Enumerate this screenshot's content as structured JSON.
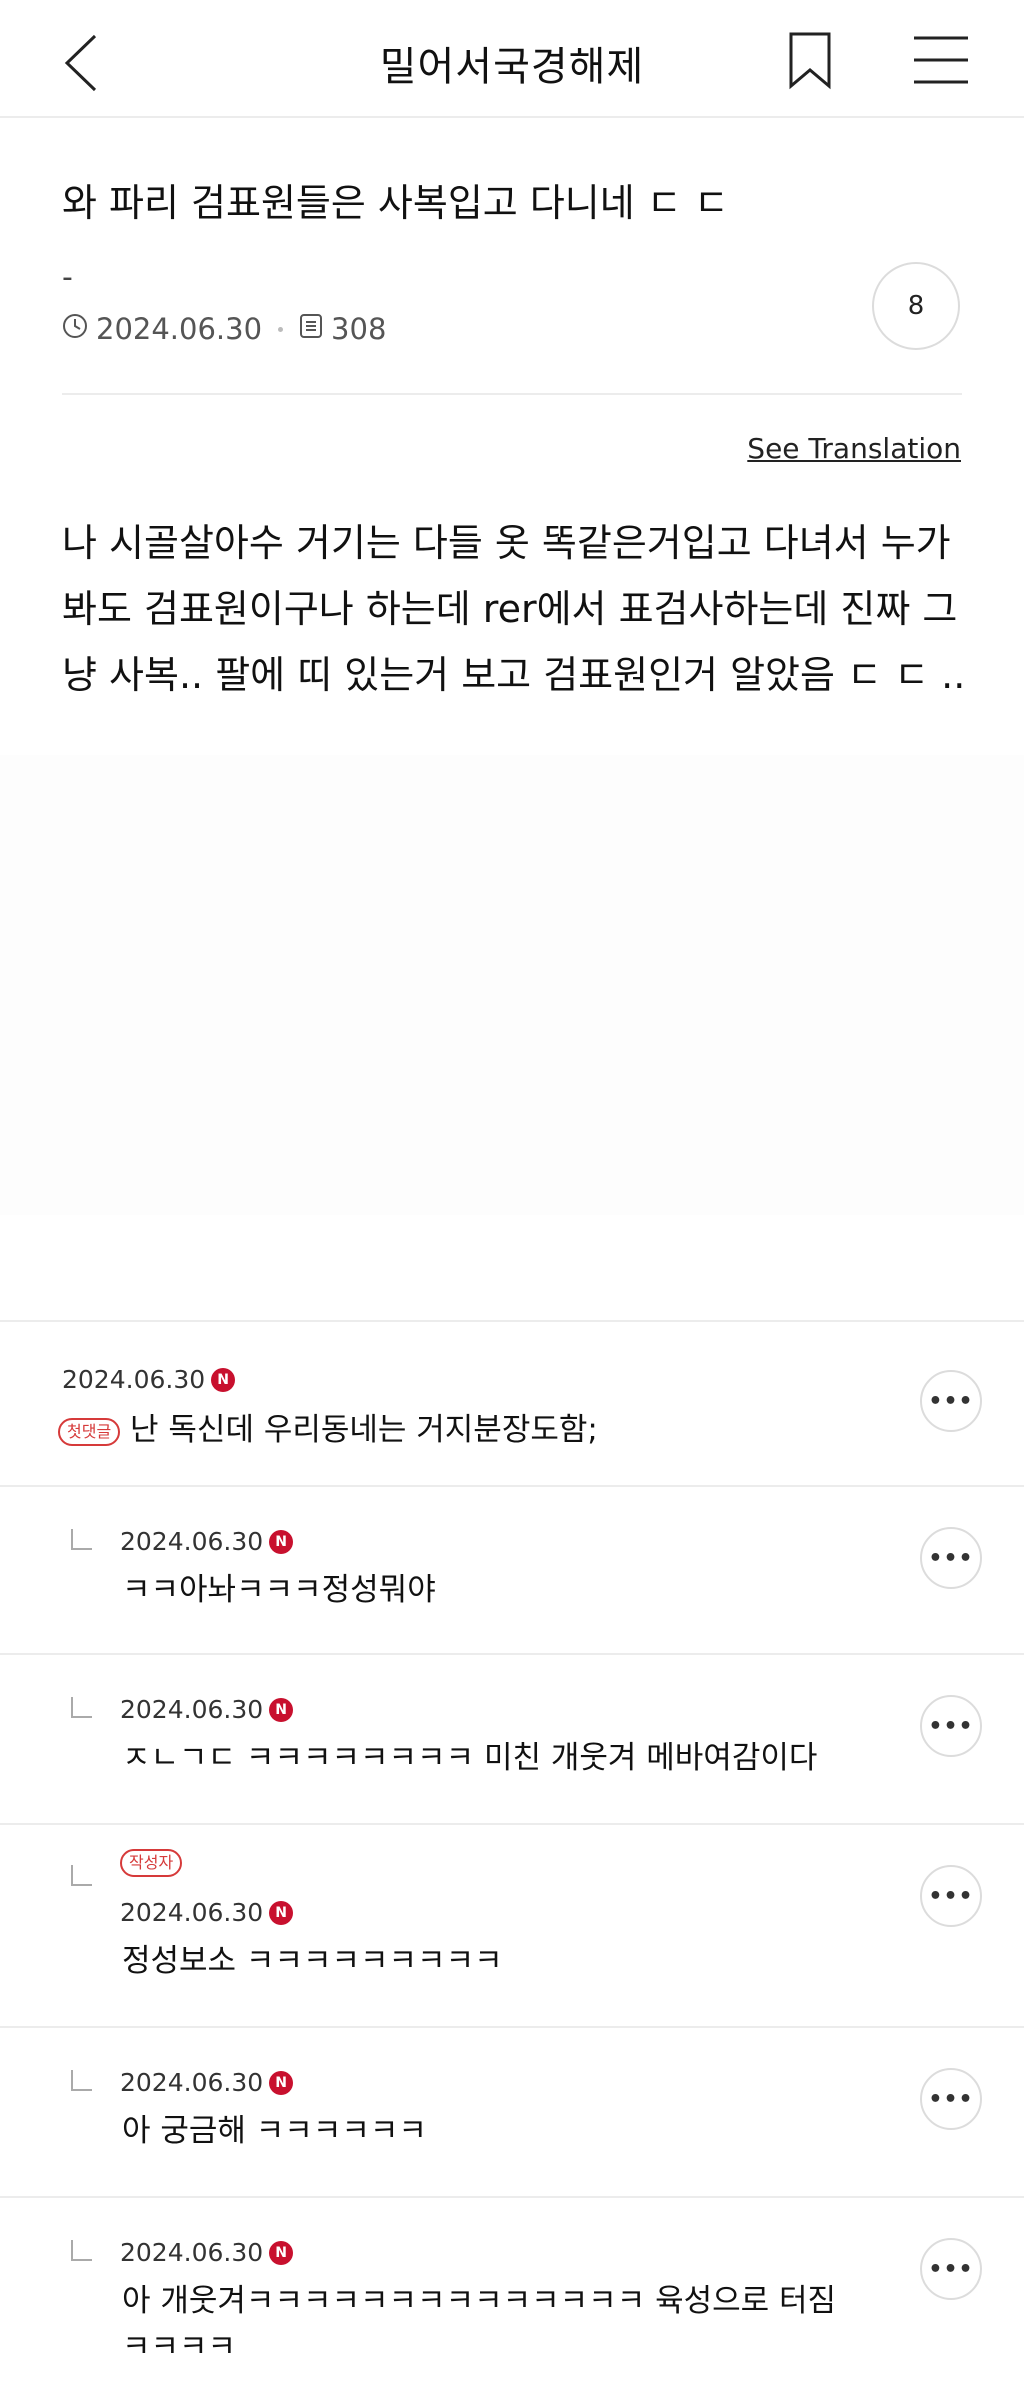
{
  "header": {
    "title": "밀어서국경해제",
    "back_icon": "chevron-left-icon",
    "bookmark_icon": "bookmark-icon",
    "menu_icon": "hamburger-menu-icon"
  },
  "post": {
    "title": "와 파리 검표원들은 사복입고 다니네 ㄷ ㄷ",
    "author": "-",
    "date": "2024.06.30",
    "views": "308",
    "comment_count": "8",
    "see_translation": "See Translation",
    "body": "나 시골살아수 거기는 다들 옷 똑같은거입고 다녀서 누가 봐도 검표원이구나 하는데 rer에서 표검사하는데 진짜 그냥 사복.. 팔에 띠 있는거 보고 검표원인거 알았음 ㄷ ㄷ .."
  },
  "comments": [
    {
      "date": "2024.06.30",
      "badge": "N",
      "first_label": "첫댓글",
      "text": "난 독신데 우리동네는 거지분장도함;"
    },
    {
      "date": "2024.06.30",
      "badge": "N",
      "text": "ㅋㅋ아놔ㅋㅋㅋ정성뭐야"
    },
    {
      "date": "2024.06.30",
      "badge": "N",
      "text": "ㅈㄴㄱㄷ ㅋㅋㅋㅋㅋㅋㅋㅋ 미친 개웃겨 메바여감이다"
    },
    {
      "date": "2024.06.30",
      "badge": "N",
      "author_label": "작성자",
      "text": "정성보소 ㅋㅋㅋㅋㅋㅋㅋㅋㅋ"
    },
    {
      "date": "2024.06.30",
      "badge": "N",
      "text": "아 궁금해 ㅋㅋㅋㅋㅋㅋ"
    },
    {
      "date": "2024.06.30",
      "badge": "N",
      "text": "아 개웃겨ㅋㅋㅋㅋㅋㅋㅋㅋㅋㅋㅋㅋㅋㅋ 육성으로 터짐",
      "text2": "ㅋㅋㅋㅋ"
    }
  ]
}
